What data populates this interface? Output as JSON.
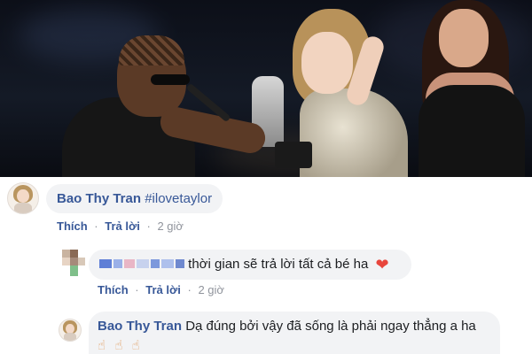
{
  "comments": [
    {
      "author": "Bao Thy Tran",
      "text": "#ilovetaylor",
      "actions": {
        "like": "Thích",
        "reply": "Trả lời",
        "separator": "·",
        "time": "2 giờ"
      }
    },
    {
      "author": "",
      "text": "thời gian sẽ trả lời tất cả bé ha",
      "emoji": "heart-emoji",
      "actions": {
        "like": "Thích",
        "reply": "Trả lời",
        "separator": "·",
        "time": "2 giờ"
      }
    },
    {
      "author": "Bao Thy Tran",
      "text": "Dạ đúng bởi vậy đã sống là phải ngay thẳng a ha",
      "emoji": "pointing-hand-emoji"
    }
  ],
  "colors": {
    "author_link": "#385898",
    "bubble_bg": "#f2f3f5",
    "heart": "#e8453c",
    "muted": "#90949c"
  }
}
